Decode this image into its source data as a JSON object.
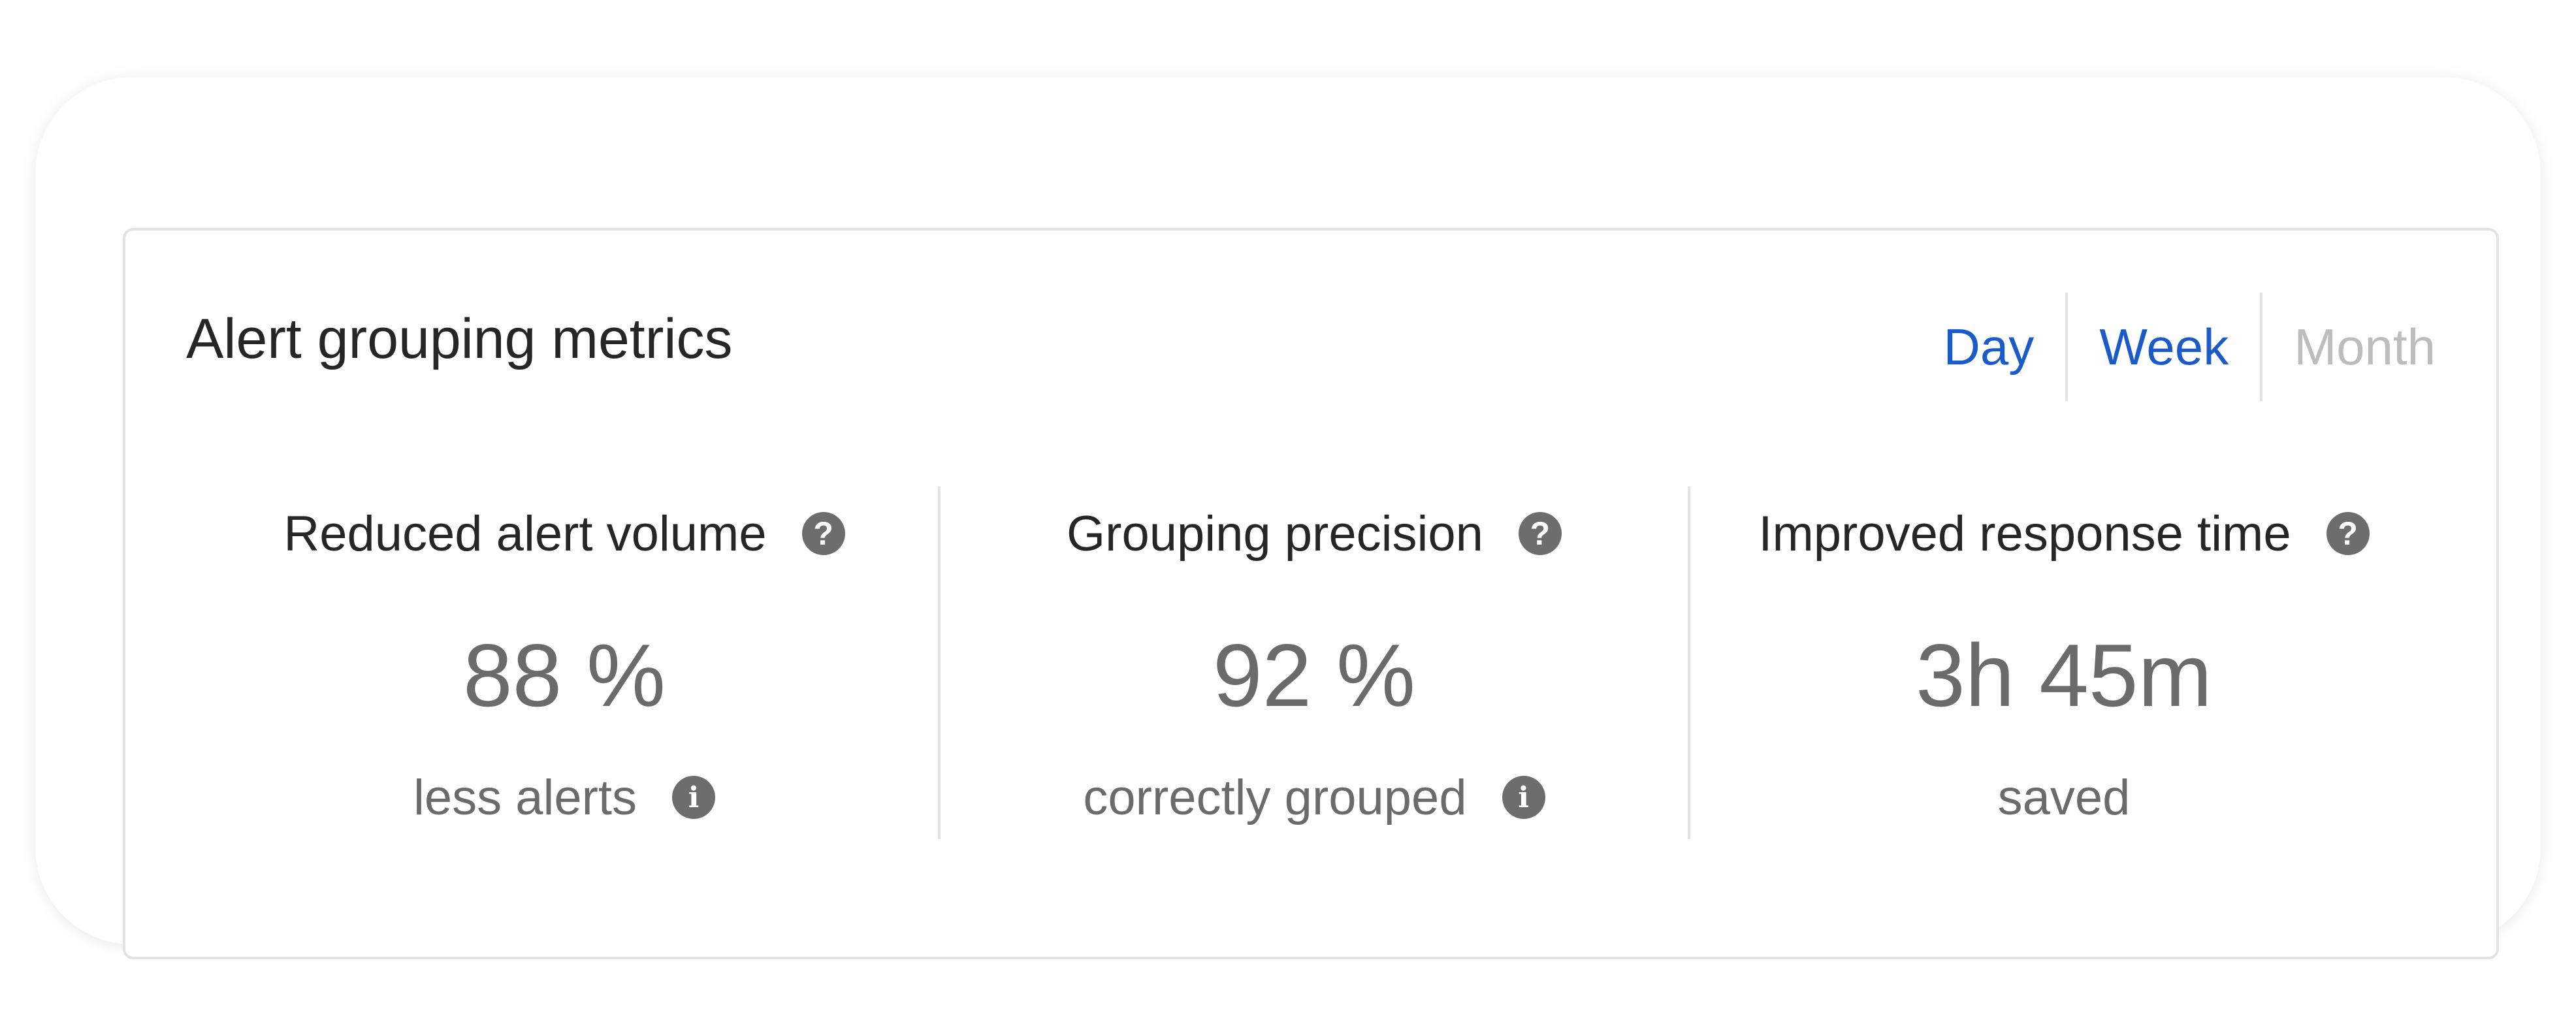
{
  "widget": {
    "title": "Alert grouping metrics",
    "period_tabs": [
      {
        "label": "Day",
        "state": "active"
      },
      {
        "label": "Week",
        "state": "active"
      },
      {
        "label": "Month",
        "state": "disabled"
      }
    ],
    "metrics": [
      {
        "label": "Reduced alert volume",
        "value": "88 %",
        "sublabel": "less alerts",
        "help_icon": "question-circle-icon",
        "info_icon": "info-circle-icon"
      },
      {
        "label": "Grouping precision",
        "value": "92 %",
        "sublabel": "correctly grouped",
        "help_icon": "question-circle-icon",
        "info_icon": "info-circle-icon"
      },
      {
        "label": "Improved response time",
        "value": "3h 45m",
        "sublabel": "saved",
        "help_icon": "question-circle-icon"
      }
    ]
  },
  "colors": {
    "accent": "#1a5bc9",
    "disabled": "#bdbdbd",
    "heading_text": "#262626",
    "value_text": "#6b6b6b",
    "border": "#e3e3e3",
    "icon_fill": "#6d6d6d"
  },
  "icons": {
    "question-circle-icon": "?",
    "info-circle-icon": "i"
  }
}
